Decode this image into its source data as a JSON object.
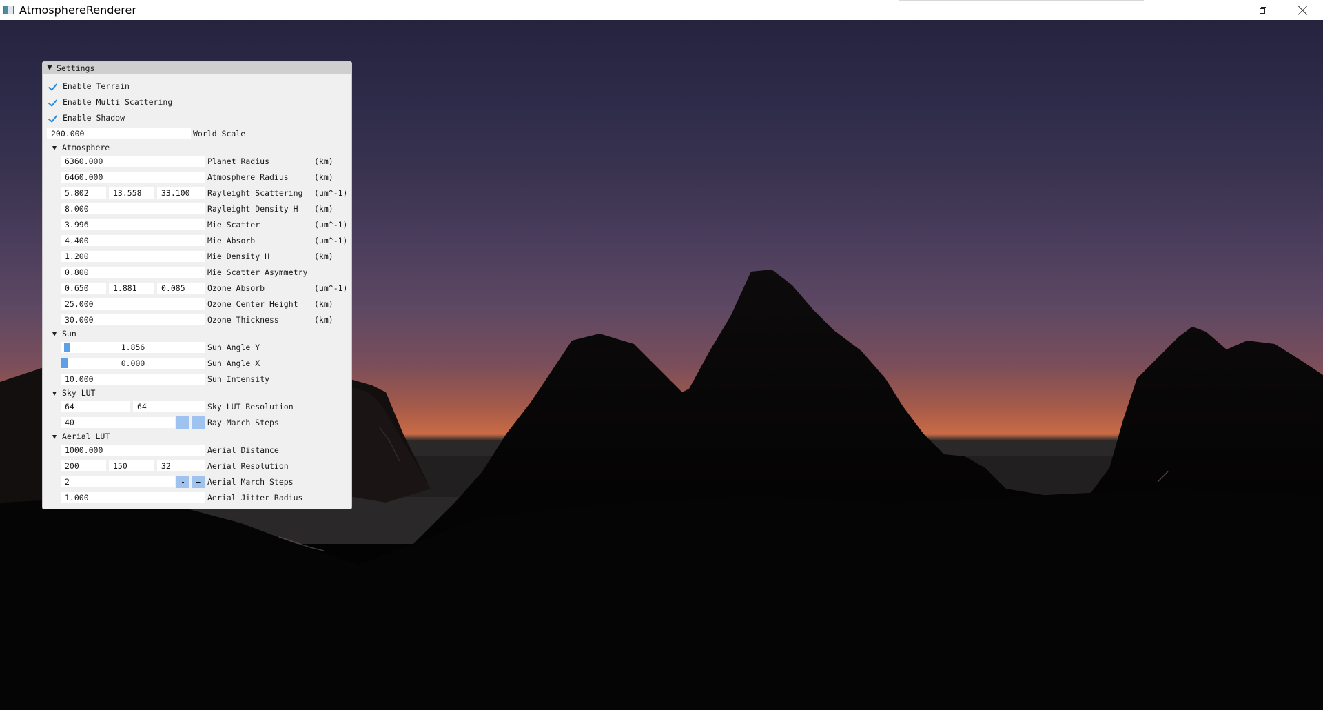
{
  "window": {
    "title": "AtmosphereRenderer",
    "icons": {
      "app": "app-window-icon",
      "minimize": "minimize-icon",
      "restore": "restore-icon",
      "close": "close-icon"
    }
  },
  "colors": {
    "panel_bg": "#f0f0f0",
    "panel_header": "#cfcfcf",
    "check_accent": "#2b8ad8",
    "slider_grab": "#5e9fe6",
    "button_bg": "#9dc3ee"
  },
  "settings": {
    "title": "Settings",
    "enable_terrain": {
      "label": "Enable Terrain",
      "checked": true
    },
    "enable_multi_scattering": {
      "label": "Enable Multi Scattering",
      "checked": true
    },
    "enable_shadow": {
      "label": "Enable Shadow",
      "checked": true
    },
    "world_scale": {
      "value": "200.000",
      "label": "World Scale"
    },
    "atmosphere": {
      "title": "Atmosphere",
      "planet_radius": {
        "value": "6360.000",
        "label": "Planet Radius",
        "unit": "(km)"
      },
      "atmosphere_radius": {
        "value": "6460.000",
        "label": "Atmosphere Radius",
        "unit": "(km)"
      },
      "rayleight_scattering": {
        "values": [
          "5.802",
          "13.558",
          "33.100"
        ],
        "label": "Rayleight Scattering",
        "unit": "(um^-1)"
      },
      "rayleight_density_h": {
        "value": "8.000",
        "label": "Rayleight Density H",
        "unit": "(km)"
      },
      "mie_scatter": {
        "value": "3.996",
        "label": "Mie Scatter",
        "unit": "(um^-1)"
      },
      "mie_absorb": {
        "value": "4.400",
        "label": "Mie Absorb",
        "unit": "(um^-1)"
      },
      "mie_density_h": {
        "value": "1.200",
        "label": "Mie Density H",
        "unit": "(km)"
      },
      "mie_scatter_asymmetry": {
        "value": "0.800",
        "label": "Mie Scatter Asymmetry"
      },
      "ozone_absorb": {
        "values": [
          "0.650",
          "1.881",
          "0.085"
        ],
        "label": "Ozone Absorb",
        "unit": "(um^-1)"
      },
      "ozone_center_height": {
        "value": "25.000",
        "label": "Ozone Center Height",
        "unit": "(km)"
      },
      "ozone_thickness": {
        "value": "30.000",
        "label": "Ozone Thickness",
        "unit": "(km)"
      }
    },
    "sun": {
      "title": "Sun",
      "sun_angle_y": {
        "value": "1.856",
        "label": "Sun Angle Y"
      },
      "sun_angle_x": {
        "value": "0.000",
        "label": "Sun Angle X"
      },
      "sun_intensity": {
        "value": "10.000",
        "label": "Sun Intensity"
      }
    },
    "sky_lut": {
      "title": "Sky LUT",
      "sky_lut_resolution": {
        "values": [
          "64",
          "64"
        ],
        "label": "Sky LUT Resolution"
      },
      "ray_march_steps": {
        "value": "40",
        "label": "Ray March Steps",
        "minus": "-",
        "plus": "+"
      }
    },
    "aerial_lut": {
      "title": "Aerial LUT",
      "aerial_distance": {
        "value": "1000.000",
        "label": "Aerial Distance"
      },
      "aerial_resolution": {
        "values": [
          "200",
          "150",
          "32"
        ],
        "label": "Aerial Resolution"
      },
      "aerial_march_steps": {
        "value": "2",
        "label": "Aerial March Steps",
        "minus": "-",
        "plus": "+"
      },
      "aerial_jitter_radius": {
        "value": "1.000",
        "label": "Aerial Jitter Radius"
      }
    }
  }
}
